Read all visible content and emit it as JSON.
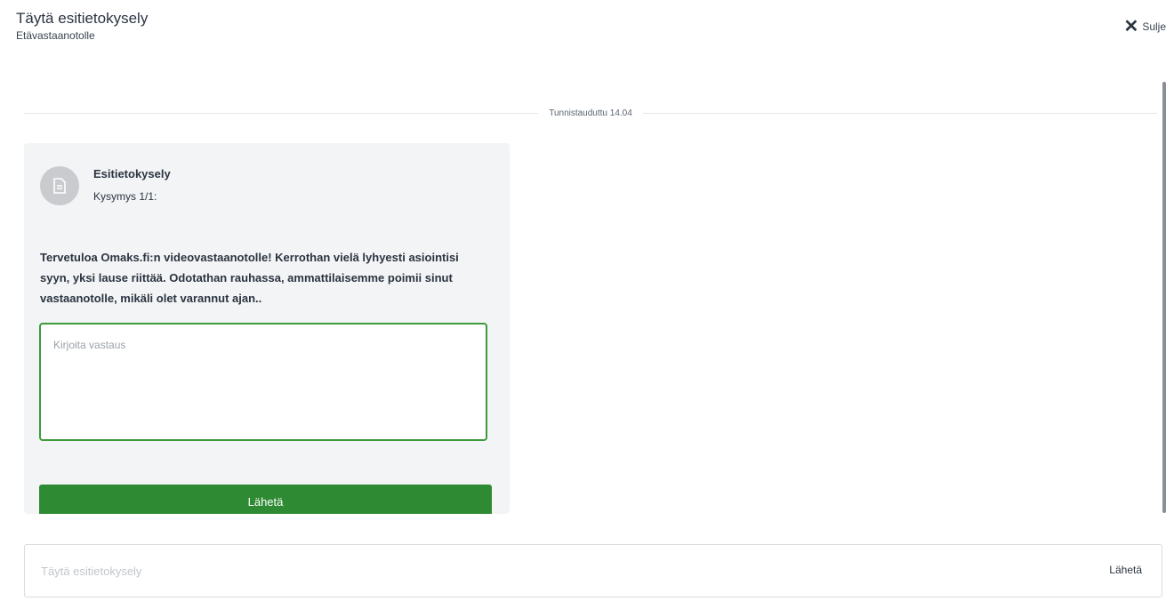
{
  "header": {
    "title": "Täytä esitietokysely",
    "subtitle": "Etävastaanotolle",
    "close_label": "Sulje"
  },
  "divider": {
    "label": "Tunnistauduttu 14.04"
  },
  "card": {
    "icon": "document-icon",
    "title": "Esitietokysely",
    "question_counter": "Kysymys 1/1:",
    "question_text": "Tervetuloa Omaks.fi:n videovastaanotolle! Kerrothan vielä lyhyesti asiointisi syyn, yksi lause riittää. Odotathan rauhassa, ammattilaisemme poimii sinut vastaanotolle, mikäli olet varannut ajan..",
    "answer_placeholder": "Kirjoita vastaus",
    "answer_value": "",
    "send_label": "Lähetä"
  },
  "bottom_bar": {
    "input_placeholder": "Täytä esitietokysely",
    "send_label": "Lähetä"
  },
  "colors": {
    "accent_green": "#2e8b33",
    "input_border_green": "#3e9a3a",
    "card_background": "#f3f4f6"
  }
}
